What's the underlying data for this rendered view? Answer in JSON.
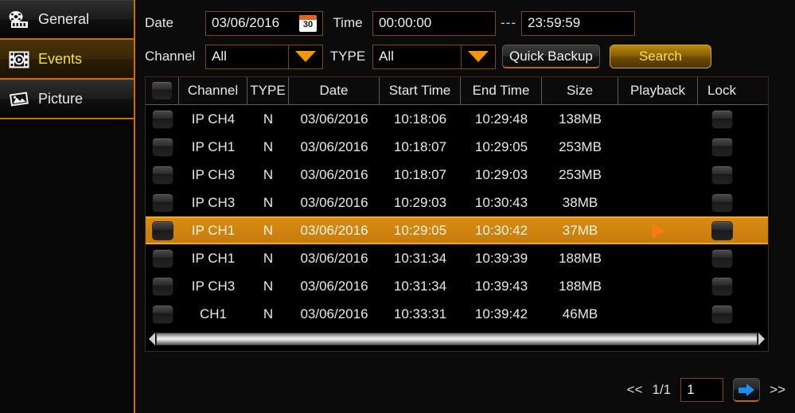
{
  "sidebar": {
    "items": [
      {
        "label": "General",
        "icon": "film-reel-icon",
        "active": false
      },
      {
        "label": "Events",
        "icon": "film-strip-play-icon",
        "active": true
      },
      {
        "label": "Picture",
        "icon": "photo-icon",
        "active": false
      }
    ]
  },
  "search_form": {
    "date_label": "Date",
    "date_value": "03/06/2016",
    "calendar_icon_day": "30",
    "time_label": "Time",
    "time_start": "00:00:00",
    "time_separator": "---",
    "time_end": "23:59:59",
    "channel_label": "Channel",
    "channel_value": "All",
    "type_label": "TYPE",
    "type_value": "All",
    "quick_backup_label": "Quick Backup",
    "search_label": "Search"
  },
  "table": {
    "columns": [
      "",
      "Channel",
      "TYPE",
      "Date",
      "Start Time",
      "End Time",
      "Size",
      "Playback",
      "Lock"
    ],
    "rows": [
      {
        "channel": "IP CH4",
        "type": "N",
        "date": "03/06/2016",
        "start": "10:18:06",
        "end": "10:29:48",
        "size": "138MB",
        "selected": false
      },
      {
        "channel": "IP CH1",
        "type": "N",
        "date": "03/06/2016",
        "start": "10:18:07",
        "end": "10:29:05",
        "size": "253MB",
        "selected": false
      },
      {
        "channel": "IP CH3",
        "type": "N",
        "date": "03/06/2016",
        "start": "10:18:07",
        "end": "10:29:03",
        "size": "253MB",
        "selected": false
      },
      {
        "channel": "IP CH3",
        "type": "N",
        "date": "03/06/2016",
        "start": "10:29:03",
        "end": "10:30:43",
        "size": "38MB",
        "selected": false
      },
      {
        "channel": "IP CH1",
        "type": "N",
        "date": "03/06/2016",
        "start": "10:29:05",
        "end": "10:30:42",
        "size": "37MB",
        "selected": true
      },
      {
        "channel": "IP CH1",
        "type": "N",
        "date": "03/06/2016",
        "start": "10:31:34",
        "end": "10:39:39",
        "size": "188MB",
        "selected": false
      },
      {
        "channel": "IP CH3",
        "type": "N",
        "date": "03/06/2016",
        "start": "10:31:34",
        "end": "10:39:43",
        "size": "188MB",
        "selected": false
      },
      {
        "channel": "CH1",
        "type": "N",
        "date": "03/06/2016",
        "start": "10:33:31",
        "end": "10:39:42",
        "size": "46MB",
        "selected": false
      }
    ]
  },
  "pager": {
    "prev_label": "<<",
    "page_indicator": "1/1",
    "page_input_value": "1",
    "go_icon": "arrow-right-icon",
    "next_label": ">>"
  },
  "colors": {
    "accent_orange": "#c86a10",
    "selected_row": "#c87c0c",
    "active_text": "#f5e03a",
    "play_triangle": "#ff7a14",
    "go_arrow_blue": "#1a8ff0"
  }
}
